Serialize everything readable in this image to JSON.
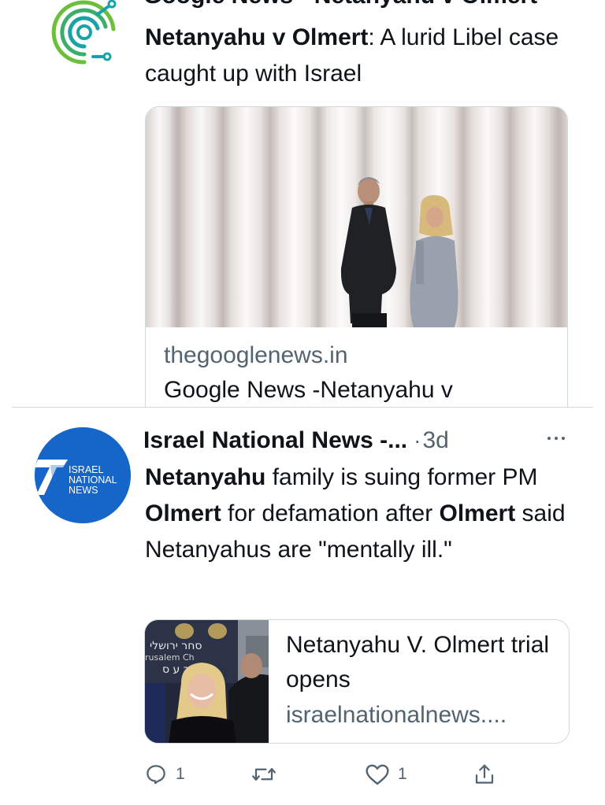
{
  "tweet1": {
    "cut_line": "Google News - Netanyahu v Olmert",
    "text_parts": [
      {
        "bold": true,
        "text": "Netanyahu v Olmert"
      },
      {
        "bold": false,
        "text": ": A lurid Libel case caught up with Israel"
      }
    ],
    "card": {
      "domain": "thegooglenews.in",
      "title": "Google News -Netanyahu v"
    }
  },
  "tweet2": {
    "avatar_text": [
      "ISRAEL",
      "NATIONAL",
      "NEWS"
    ],
    "author": "Israel National News -...",
    "separator": "·",
    "timestamp": "3d",
    "text_parts": [
      {
        "bold": true,
        "text": "Netanyahu"
      },
      {
        "bold": false,
        "text": " family is suing former PM "
      },
      {
        "bold": true,
        "text": "Olmert"
      },
      {
        "bold": false,
        "text": " for defamation after "
      },
      {
        "bold": true,
        "text": "Olmert"
      },
      {
        "bold": false,
        "text": " said Netanyahus are \"mentally ill.\""
      }
    ],
    "card": {
      "title": "Netanyahu V. Olmert trial opens",
      "domain": "israelnationalnews....",
      "thumb_text": [
        "סחר ירושלי",
        "rusalem Ch",
        "ר ע ס"
      ]
    },
    "actions": {
      "reply_count": "1",
      "retweet_count": "",
      "like_count": "1"
    }
  },
  "icons": {
    "reply": "reply-icon",
    "retweet": "retweet-icon",
    "like": "heart-icon",
    "share": "share-icon",
    "more": "more-icon"
  },
  "colors": {
    "text": "#0f1419",
    "secondary": "#536471",
    "border": "#cfd9de",
    "ins_blue": "#1566c8",
    "logo_green": "#6bbf3a",
    "logo_teal": "#19a3a8"
  }
}
